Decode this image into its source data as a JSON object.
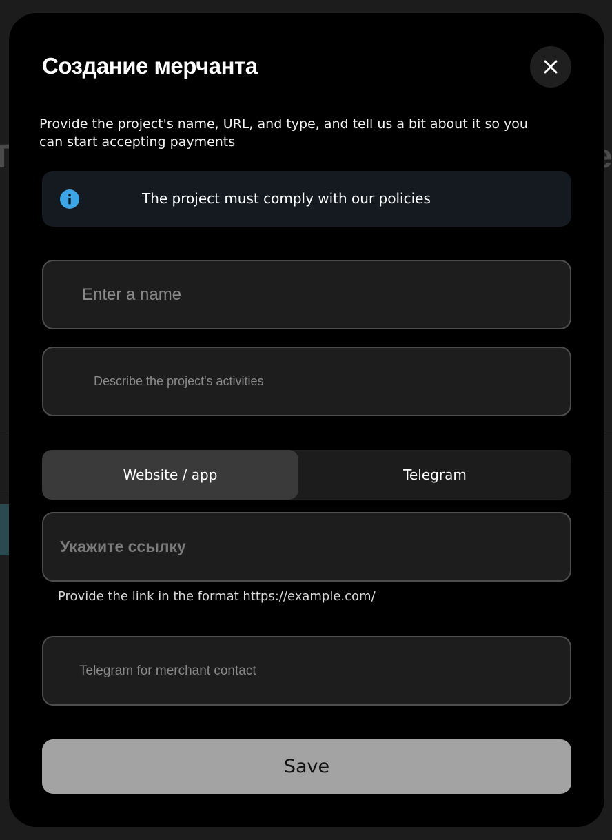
{
  "modal": {
    "title": "Создание мерчанта",
    "description": "Provide the project's name, URL, and type, and tell us a bit about it so you can start accepting payments",
    "close_icon": "close-icon"
  },
  "notice": {
    "icon": "info-icon",
    "text": "The project must comply with our policies",
    "icon_color": "#3ba5e6"
  },
  "form": {
    "name_placeholder": "Enter a name",
    "description_placeholder": "Describe the project's activities",
    "type_tabs": [
      {
        "label": "Website / app",
        "selected": true
      },
      {
        "label": "Telegram",
        "selected": false
      }
    ],
    "url_placeholder": "Укажите ссылку",
    "url_hint": "Provide the link in the format https://example.com/",
    "telegram_placeholder": "Telegram for merchant contact",
    "save_label": "Save"
  },
  "colors": {
    "modal_background": "#000000",
    "field_background": "#1d1d1d",
    "field_border": "#4d4d4d",
    "save_button_disabled": "#a3a3a3"
  }
}
